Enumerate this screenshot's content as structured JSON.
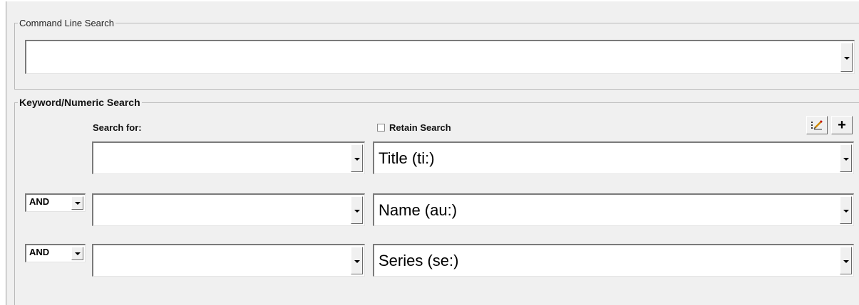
{
  "command_line_search": {
    "legend": "Command Line Search",
    "value": ""
  },
  "keyword_search": {
    "legend": "Keyword/Numeric Search",
    "search_for_label": "Search for:",
    "retain_search_label": "Retain Search",
    "retain_search_checked": false,
    "add_button_label": "+",
    "edit_icon": "edit-list-icon",
    "rows": [
      {
        "operator": "",
        "term": "",
        "index": "Title (ti:)"
      },
      {
        "operator": "AND",
        "term": "",
        "index": "Name (au:)"
      },
      {
        "operator": "AND",
        "term": "",
        "index": "Series (se:)"
      }
    ]
  }
}
